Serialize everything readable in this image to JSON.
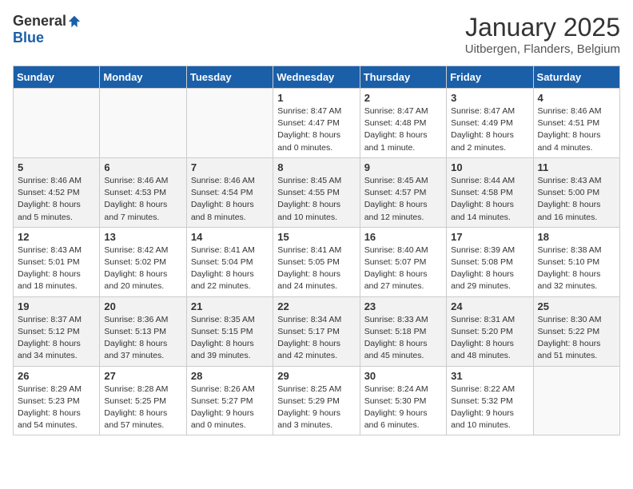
{
  "header": {
    "logo_general": "General",
    "logo_blue": "Blue",
    "title": "January 2025",
    "location": "Uitbergen, Flanders, Belgium"
  },
  "weekdays": [
    "Sunday",
    "Monday",
    "Tuesday",
    "Wednesday",
    "Thursday",
    "Friday",
    "Saturday"
  ],
  "weeks": [
    [
      {
        "day": "",
        "info": ""
      },
      {
        "day": "",
        "info": ""
      },
      {
        "day": "",
        "info": ""
      },
      {
        "day": "1",
        "info": "Sunrise: 8:47 AM\nSunset: 4:47 PM\nDaylight: 8 hours\nand 0 minutes."
      },
      {
        "day": "2",
        "info": "Sunrise: 8:47 AM\nSunset: 4:48 PM\nDaylight: 8 hours\nand 1 minute."
      },
      {
        "day": "3",
        "info": "Sunrise: 8:47 AM\nSunset: 4:49 PM\nDaylight: 8 hours\nand 2 minutes."
      },
      {
        "day": "4",
        "info": "Sunrise: 8:46 AM\nSunset: 4:51 PM\nDaylight: 8 hours\nand 4 minutes."
      }
    ],
    [
      {
        "day": "5",
        "info": "Sunrise: 8:46 AM\nSunset: 4:52 PM\nDaylight: 8 hours\nand 5 minutes."
      },
      {
        "day": "6",
        "info": "Sunrise: 8:46 AM\nSunset: 4:53 PM\nDaylight: 8 hours\nand 7 minutes."
      },
      {
        "day": "7",
        "info": "Sunrise: 8:46 AM\nSunset: 4:54 PM\nDaylight: 8 hours\nand 8 minutes."
      },
      {
        "day": "8",
        "info": "Sunrise: 8:45 AM\nSunset: 4:55 PM\nDaylight: 8 hours\nand 10 minutes."
      },
      {
        "day": "9",
        "info": "Sunrise: 8:45 AM\nSunset: 4:57 PM\nDaylight: 8 hours\nand 12 minutes."
      },
      {
        "day": "10",
        "info": "Sunrise: 8:44 AM\nSunset: 4:58 PM\nDaylight: 8 hours\nand 14 minutes."
      },
      {
        "day": "11",
        "info": "Sunrise: 8:43 AM\nSunset: 5:00 PM\nDaylight: 8 hours\nand 16 minutes."
      }
    ],
    [
      {
        "day": "12",
        "info": "Sunrise: 8:43 AM\nSunset: 5:01 PM\nDaylight: 8 hours\nand 18 minutes."
      },
      {
        "day": "13",
        "info": "Sunrise: 8:42 AM\nSunset: 5:02 PM\nDaylight: 8 hours\nand 20 minutes."
      },
      {
        "day": "14",
        "info": "Sunrise: 8:41 AM\nSunset: 5:04 PM\nDaylight: 8 hours\nand 22 minutes."
      },
      {
        "day": "15",
        "info": "Sunrise: 8:41 AM\nSunset: 5:05 PM\nDaylight: 8 hours\nand 24 minutes."
      },
      {
        "day": "16",
        "info": "Sunrise: 8:40 AM\nSunset: 5:07 PM\nDaylight: 8 hours\nand 27 minutes."
      },
      {
        "day": "17",
        "info": "Sunrise: 8:39 AM\nSunset: 5:08 PM\nDaylight: 8 hours\nand 29 minutes."
      },
      {
        "day": "18",
        "info": "Sunrise: 8:38 AM\nSunset: 5:10 PM\nDaylight: 8 hours\nand 32 minutes."
      }
    ],
    [
      {
        "day": "19",
        "info": "Sunrise: 8:37 AM\nSunset: 5:12 PM\nDaylight: 8 hours\nand 34 minutes."
      },
      {
        "day": "20",
        "info": "Sunrise: 8:36 AM\nSunset: 5:13 PM\nDaylight: 8 hours\nand 37 minutes."
      },
      {
        "day": "21",
        "info": "Sunrise: 8:35 AM\nSunset: 5:15 PM\nDaylight: 8 hours\nand 39 minutes."
      },
      {
        "day": "22",
        "info": "Sunrise: 8:34 AM\nSunset: 5:17 PM\nDaylight: 8 hours\nand 42 minutes."
      },
      {
        "day": "23",
        "info": "Sunrise: 8:33 AM\nSunset: 5:18 PM\nDaylight: 8 hours\nand 45 minutes."
      },
      {
        "day": "24",
        "info": "Sunrise: 8:31 AM\nSunset: 5:20 PM\nDaylight: 8 hours\nand 48 minutes."
      },
      {
        "day": "25",
        "info": "Sunrise: 8:30 AM\nSunset: 5:22 PM\nDaylight: 8 hours\nand 51 minutes."
      }
    ],
    [
      {
        "day": "26",
        "info": "Sunrise: 8:29 AM\nSunset: 5:23 PM\nDaylight: 8 hours\nand 54 minutes."
      },
      {
        "day": "27",
        "info": "Sunrise: 8:28 AM\nSunset: 5:25 PM\nDaylight: 8 hours\nand 57 minutes."
      },
      {
        "day": "28",
        "info": "Sunrise: 8:26 AM\nSunset: 5:27 PM\nDaylight: 9 hours\nand 0 minutes."
      },
      {
        "day": "29",
        "info": "Sunrise: 8:25 AM\nSunset: 5:29 PM\nDaylight: 9 hours\nand 3 minutes."
      },
      {
        "day": "30",
        "info": "Sunrise: 8:24 AM\nSunset: 5:30 PM\nDaylight: 9 hours\nand 6 minutes."
      },
      {
        "day": "31",
        "info": "Sunrise: 8:22 AM\nSunset: 5:32 PM\nDaylight: 9 hours\nand 10 minutes."
      },
      {
        "day": "",
        "info": ""
      }
    ]
  ]
}
